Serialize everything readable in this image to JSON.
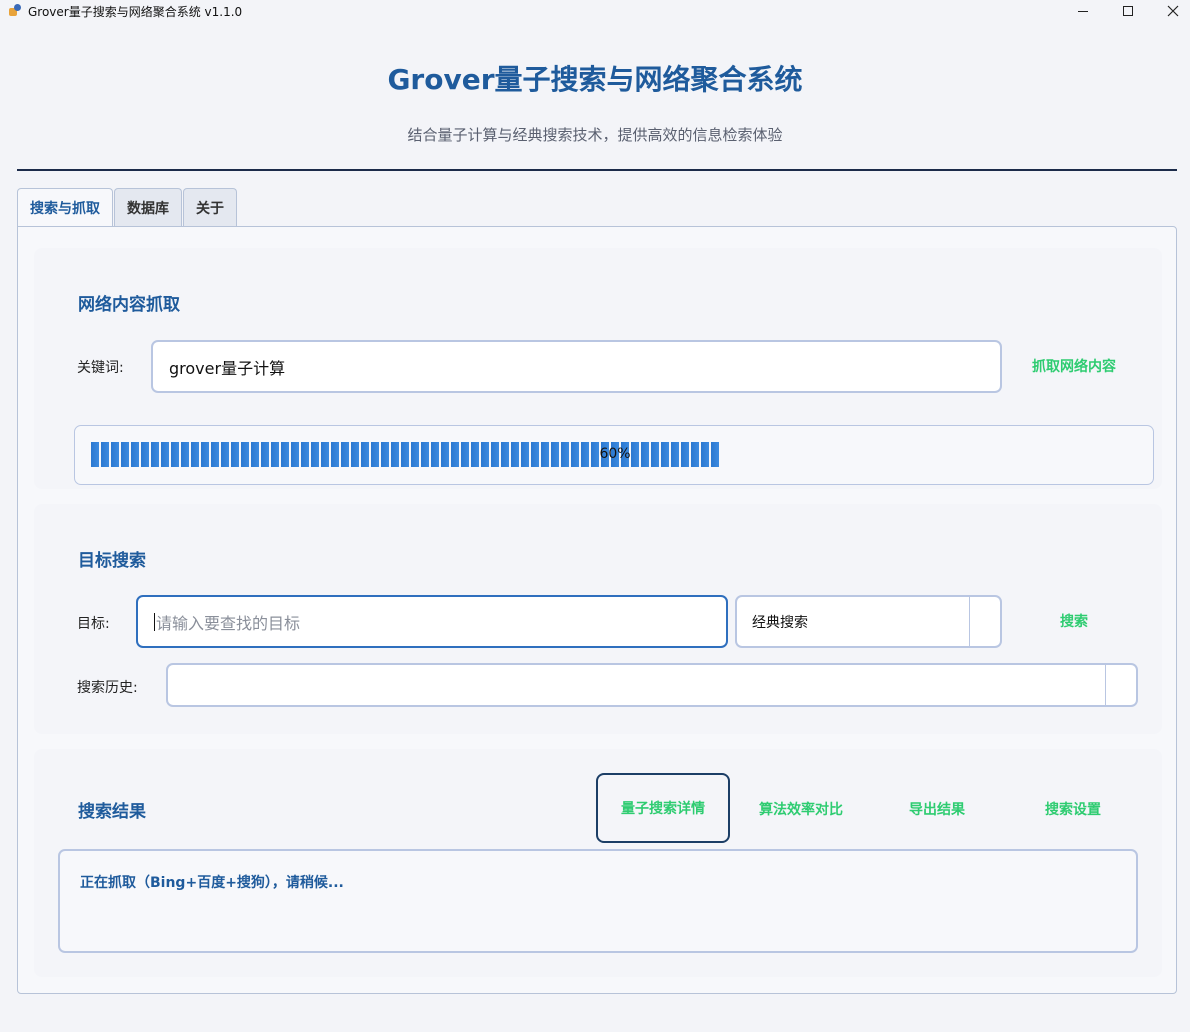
{
  "window": {
    "title": "Grover量子搜索与网络聚合系统 v1.1.0",
    "app_icon": "python-icon",
    "controls": [
      "minimize-icon",
      "maximize-icon",
      "close-icon"
    ]
  },
  "header": {
    "title": "Grover量子搜索与网络聚合系统",
    "subtitle": "结合量子计算与经典搜索技术，提供高效的信息检索体验"
  },
  "tabs": [
    {
      "label": "搜索与抓取",
      "active": true
    },
    {
      "label": "数据库",
      "active": false
    },
    {
      "label": "关于",
      "active": false
    }
  ],
  "crawl": {
    "title": "网络内容抓取",
    "keyword_label": "关键词:",
    "keyword_value": "grover量子计算",
    "crawl_button": "抓取网络内容",
    "progress_value": 60,
    "progress_text": "60%"
  },
  "target_search": {
    "title": "目标搜索",
    "target_label": "目标:",
    "target_placeholder": "请输入要查找的目标",
    "method_selected": "经典搜索",
    "search_button": "搜索",
    "history_label": "搜索历史:",
    "history_value": ""
  },
  "results": {
    "title": "搜索结果",
    "buttons": [
      "量子搜索详情",
      "算法效率对比",
      "导出结果",
      "搜索设置"
    ],
    "status_text": "正在抓取（Bing+百度+搜狗），请稍候..."
  },
  "colors": {
    "accent": "#1f5b9c",
    "button_text": "#2ecc71",
    "border": "#b9c6e2",
    "progress": "#2b78d0"
  }
}
